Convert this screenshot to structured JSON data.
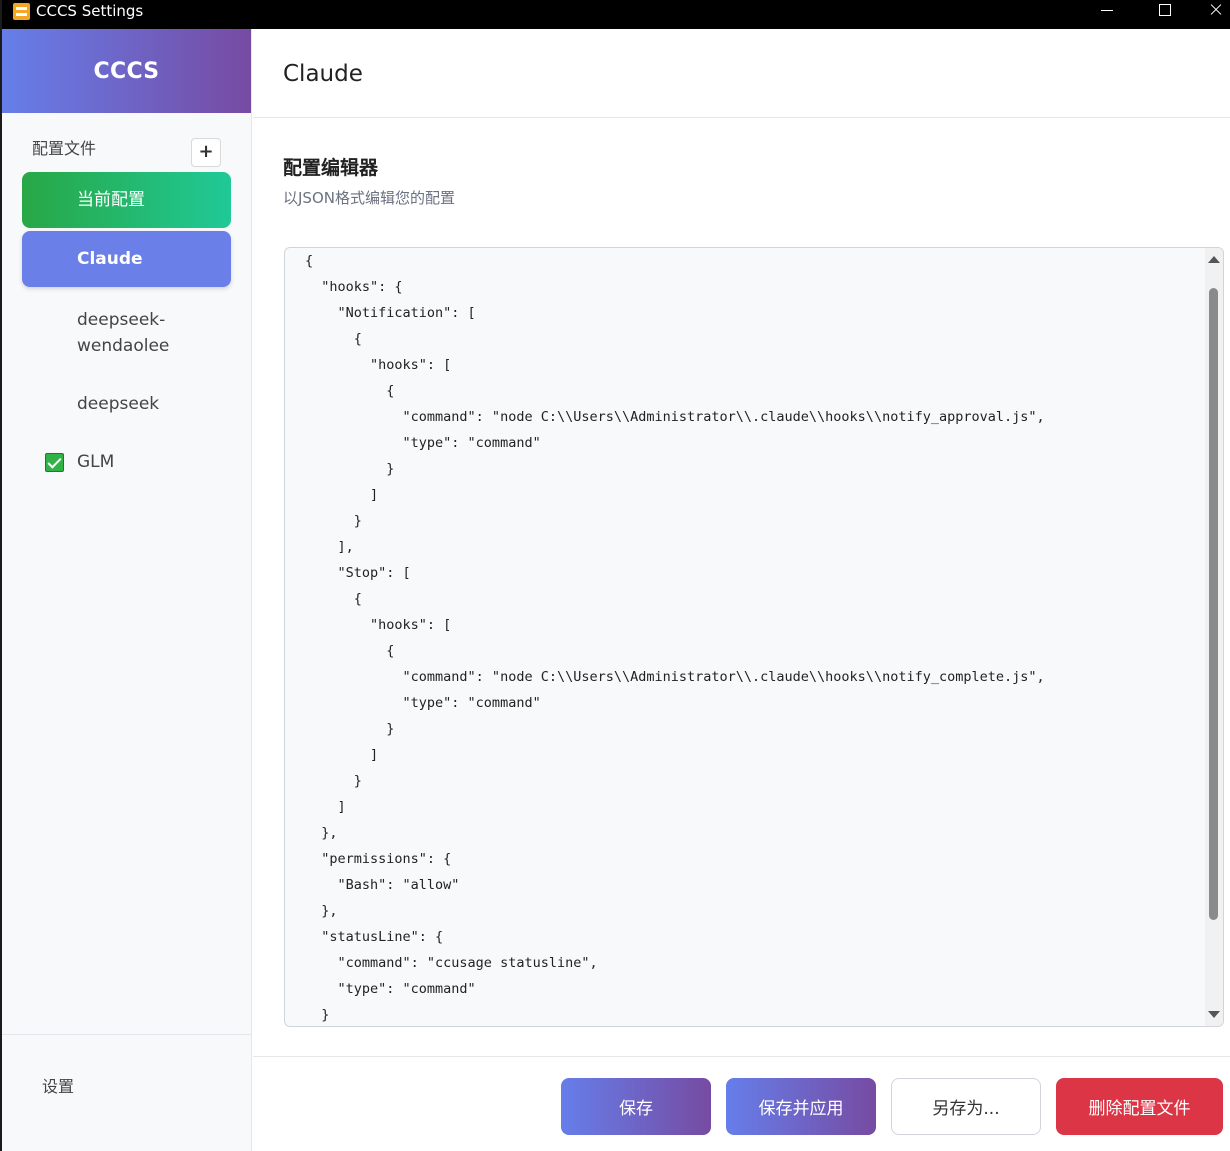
{
  "window": {
    "title": "CCCS Settings"
  },
  "sidebar": {
    "brand": "CCCS",
    "profiles_label": "配置文件",
    "add_button": "+",
    "items": [
      {
        "label": "当前配置"
      },
      {
        "label": "Claude"
      },
      {
        "label": "deepseek-\nwendaolee"
      },
      {
        "label": "deepseek"
      },
      {
        "label": "GLM",
        "checked": true
      }
    ],
    "settings_label": "设置"
  },
  "main": {
    "title": "Claude",
    "editor_title": "配置编辑器",
    "editor_subtitle": "以JSON格式编辑您的配置",
    "code_lines": [
      "{",
      "  \"hooks\": {",
      "    \"Notification\": [",
      "      {",
      "        \"hooks\": [",
      "          {",
      "            \"command\": \"node C:\\\\Users\\\\Administrator\\\\.claude\\\\hooks\\\\notify_approval.js\",",
      "            \"type\": \"command\"",
      "          }",
      "        ]",
      "      }",
      "    ],",
      "    \"Stop\": [",
      "      {",
      "        \"hooks\": [",
      "          {",
      "            \"command\": \"node C:\\\\Users\\\\Administrator\\\\.claude\\\\hooks\\\\notify_complete.js\",",
      "            \"type\": \"command\"",
      "          }",
      "        ]",
      "      }",
      "    ]",
      "  },",
      "  \"permissions\": {",
      "    \"Bash\": \"allow\"",
      "  },",
      "  \"statusLine\": {",
      "    \"command\": \"ccusage statusline\",",
      "    \"type\": \"command\"",
      "  }"
    ]
  },
  "actions": {
    "save": "保存",
    "save_apply": "保存并应用",
    "save_as": "另存为...",
    "delete": "删除配置文件"
  },
  "colors": {
    "accent_gradient_start": "#667eea",
    "accent_gradient_end": "#764ba2",
    "current_gradient_start": "#28a745",
    "current_gradient_end": "#20c997",
    "selected_item": "#6b7fe8",
    "danger": "#dc3545"
  },
  "icons": [
    "app-icon",
    "minimize-icon",
    "maximize-icon",
    "close-icon",
    "plus-icon",
    "checkbox-checked-icon",
    "scroll-up-icon",
    "scroll-down-icon"
  ]
}
